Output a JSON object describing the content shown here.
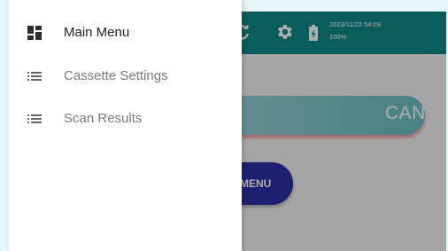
{
  "app": {
    "status": {
      "datetime": "2023/11/22 04:03",
      "battery": "100%"
    },
    "scan_label": "CAN",
    "menu_label": "MENU",
    "icons": [
      "refresh-icon",
      "gear-icon",
      "battery-charging-icon"
    ]
  },
  "drawer": {
    "items": [
      {
        "label": "Main Menu",
        "icon": "dashboard-icon",
        "active": true
      },
      {
        "label": "Cassette Settings",
        "icon": "list-icon",
        "active": false
      },
      {
        "label": "Scan Results",
        "icon": "list-icon",
        "active": false
      }
    ]
  },
  "colors": {
    "appbar": "#0e8a87",
    "menu_button": "#2b2ea6",
    "scan_button": "#7fc9cc",
    "page_background": "#e6f5f7"
  }
}
